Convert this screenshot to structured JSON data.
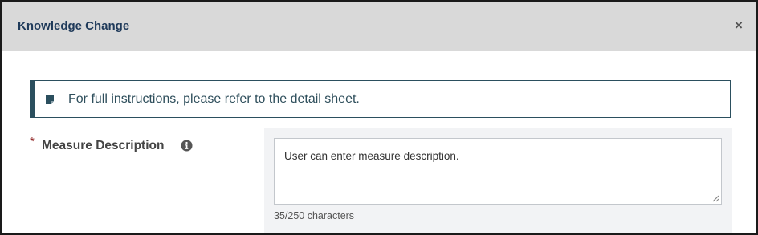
{
  "modal": {
    "title": "Knowledge Change",
    "close_label": "×"
  },
  "instructions": {
    "text": "For full instructions, please refer to the detail sheet.",
    "icon": "note-icon"
  },
  "field": {
    "required_marker": "*",
    "label": "Measure Description",
    "info_icon": "info-circle-icon",
    "value": "User can enter measure description.",
    "char_count": "35/250 characters"
  },
  "colors": {
    "header_bg": "#d9d9d9",
    "title": "#1f3a5a",
    "instruction_border": "#2b4f5e",
    "required": "#8b1a1a",
    "field_panel_bg": "#f2f3f5"
  }
}
